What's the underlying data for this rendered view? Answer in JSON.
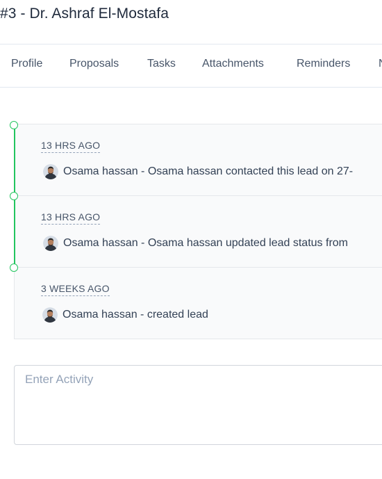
{
  "lead": {
    "title": "#3 - Dr. Ashraf El-Mostafa"
  },
  "tabs": [
    {
      "label": "Profile"
    },
    {
      "label": "Proposals"
    },
    {
      "label": "Tasks"
    },
    {
      "label": "Attachments"
    },
    {
      "label": "Reminders"
    },
    {
      "label": "N"
    }
  ],
  "activity_log": {
    "items": [
      {
        "time": "13 HRS AGO",
        "text": "Osama hassan - Osama hassan contacted this lead on 27-"
      },
      {
        "time": "13 HRS AGO",
        "text": "Osama hassan - Osama hassan updated lead status from"
      },
      {
        "time": "3 WEEKS AGO",
        "text": "Osama hassan - created lead"
      }
    ]
  },
  "activity_input": {
    "placeholder": "Enter Activity",
    "value": ""
  },
  "colors": {
    "timeline_accent": "#22c55e",
    "feed_background": "#f9fafb",
    "border": "#e5e7eb"
  },
  "icons": {
    "avatar": "user-avatar-photo"
  }
}
